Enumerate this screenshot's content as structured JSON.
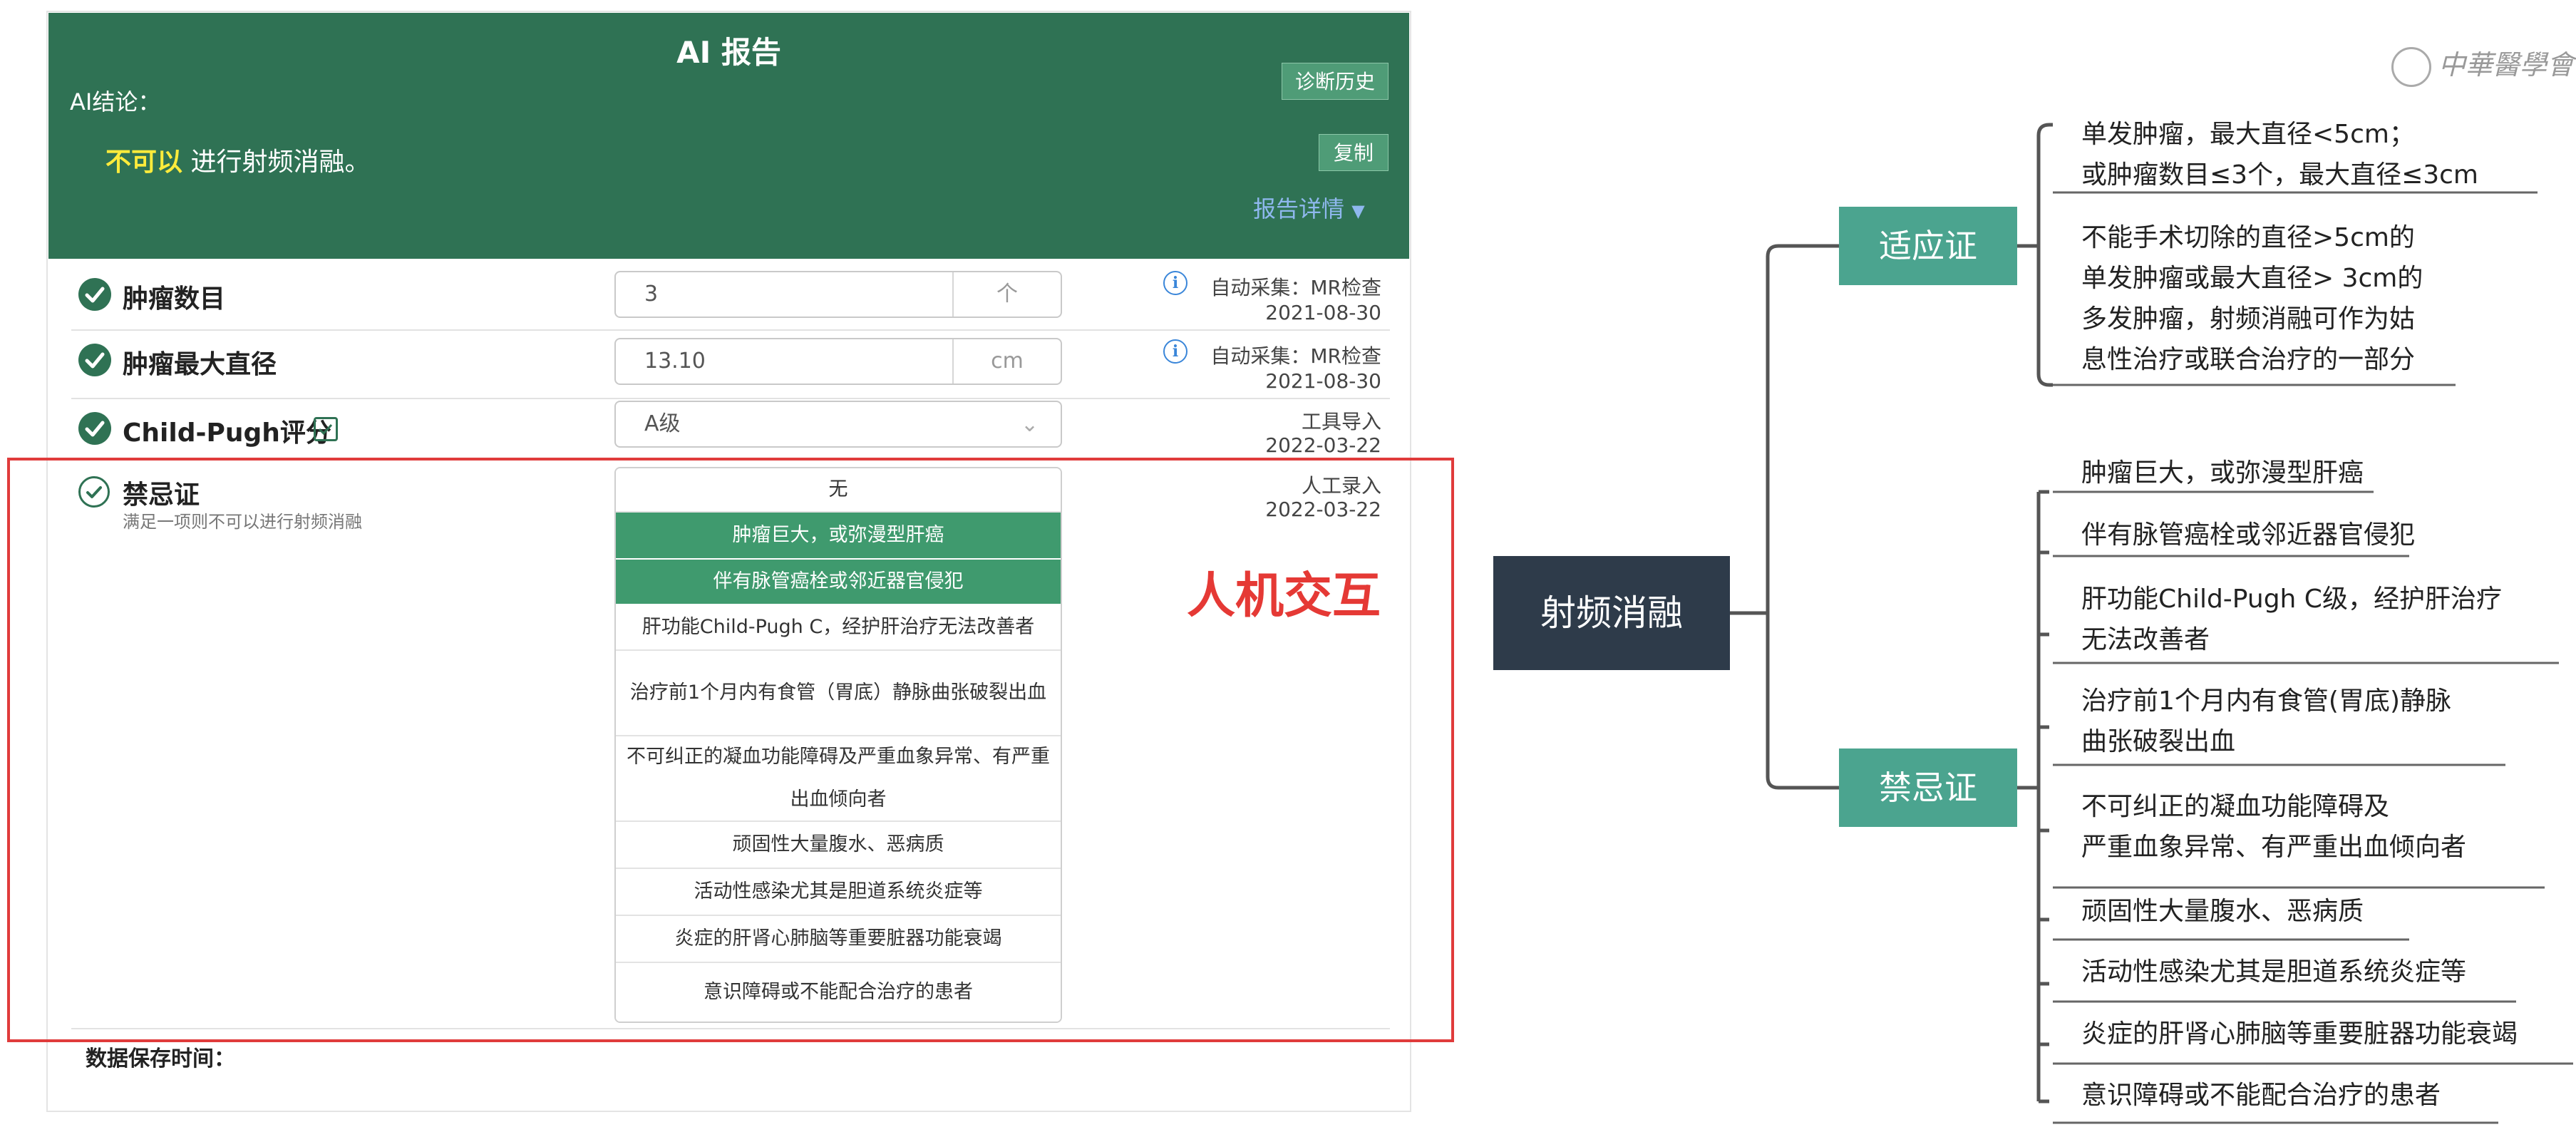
{
  "ai_report": {
    "title": "AI 报告",
    "conclusion_label": "AI结论：",
    "result_highlight": "不可以",
    "result_rest": "进行射频消融。",
    "history_button": "诊断历史",
    "copy_button": "复制",
    "detail_link": "报告详情",
    "colors": {
      "header_bg": "#2f7254",
      "button_bg": "#4f9c77",
      "highlight": "#ffeb3b"
    }
  },
  "fields": [
    {
      "label": "肿瘤数目",
      "value": "3",
      "unit": "个",
      "source": "自动采集：MR检查",
      "date": "2021-08-30"
    },
    {
      "label": "肿瘤最大直径",
      "value": "13.10",
      "unit": "cm",
      "source": "自动采集：MR检查",
      "date": "2021-08-30"
    },
    {
      "label": "Child-Pugh评分",
      "value": "A级",
      "source": "工具导入",
      "date": "2022-03-22"
    }
  ],
  "contraindication": {
    "label": "禁忌证",
    "hint": "满足一项则不可以进行射频消融",
    "source": "人工录入",
    "date": "2022-03-22",
    "options": [
      {
        "text": "无",
        "selected": false
      },
      {
        "text": "肿瘤巨大，或弥漫型肝癌",
        "selected": true
      },
      {
        "text": "伴有脉管癌栓或邻近器官侵犯",
        "selected": true
      },
      {
        "text": "肝功能Child-Pugh C，经护肝治疗无法改善者",
        "selected": false
      },
      {
        "text": "治疗前1个月内有食管（胃底）静脉曲张破裂出血",
        "selected": false
      },
      {
        "text": "不可纠正的凝血功能障碍及严重血象异常、有严重出血倾向者",
        "selected": false
      },
      {
        "text": "顽固性大量腹水、恶病质",
        "selected": false
      },
      {
        "text": "活动性感染尤其是胆道系统炎症等",
        "selected": false
      },
      {
        "text": "炎症的肝肾心肺脑等重要脏器功能衰竭",
        "selected": false
      },
      {
        "text": "意识障碍或不能配合治疗的患者",
        "selected": false
      }
    ]
  },
  "save_time_label": "数据保存时间：",
  "interaction_label": "人机交互",
  "mindmap": {
    "root": "射频消融",
    "indications": {
      "label": "适应证",
      "items": [
        "单发肿瘤，最大直径<5cm；\n或肿瘤数目≤3个，最大直径≤3cm",
        "不能手术切除的直径>5cm的\n单发肿瘤或最大直径> 3cm的\n多发肿瘤，射频消融可作为姑\n息性治疗或联合治疗的一部分"
      ]
    },
    "contraindications": {
      "label": "禁忌证",
      "items": [
        "肿瘤巨大，或弥漫型肝癌",
        "伴有脉管癌栓或邻近器官侵犯",
        "肝功能Child-Pugh C级，经护肝治疗\n无法改善者",
        "治疗前1个月内有食管(胃底)静脉\n曲张破裂出血",
        "不可纠正的凝血功能障碍及\n严重血象异常、有严重出血倾向者",
        "顽固性大量腹水、恶病质",
        "活动性感染尤其是胆道系统炎症等",
        "炎症的肝肾心肺脑等重要脏器功能衰竭",
        "意识障碍或不能配合治疗的患者"
      ]
    },
    "colors": {
      "root_bg": "#2e3b4a",
      "branch_bg": "#4ba48f"
    }
  },
  "logo": {
    "text": "中華醫學會"
  }
}
